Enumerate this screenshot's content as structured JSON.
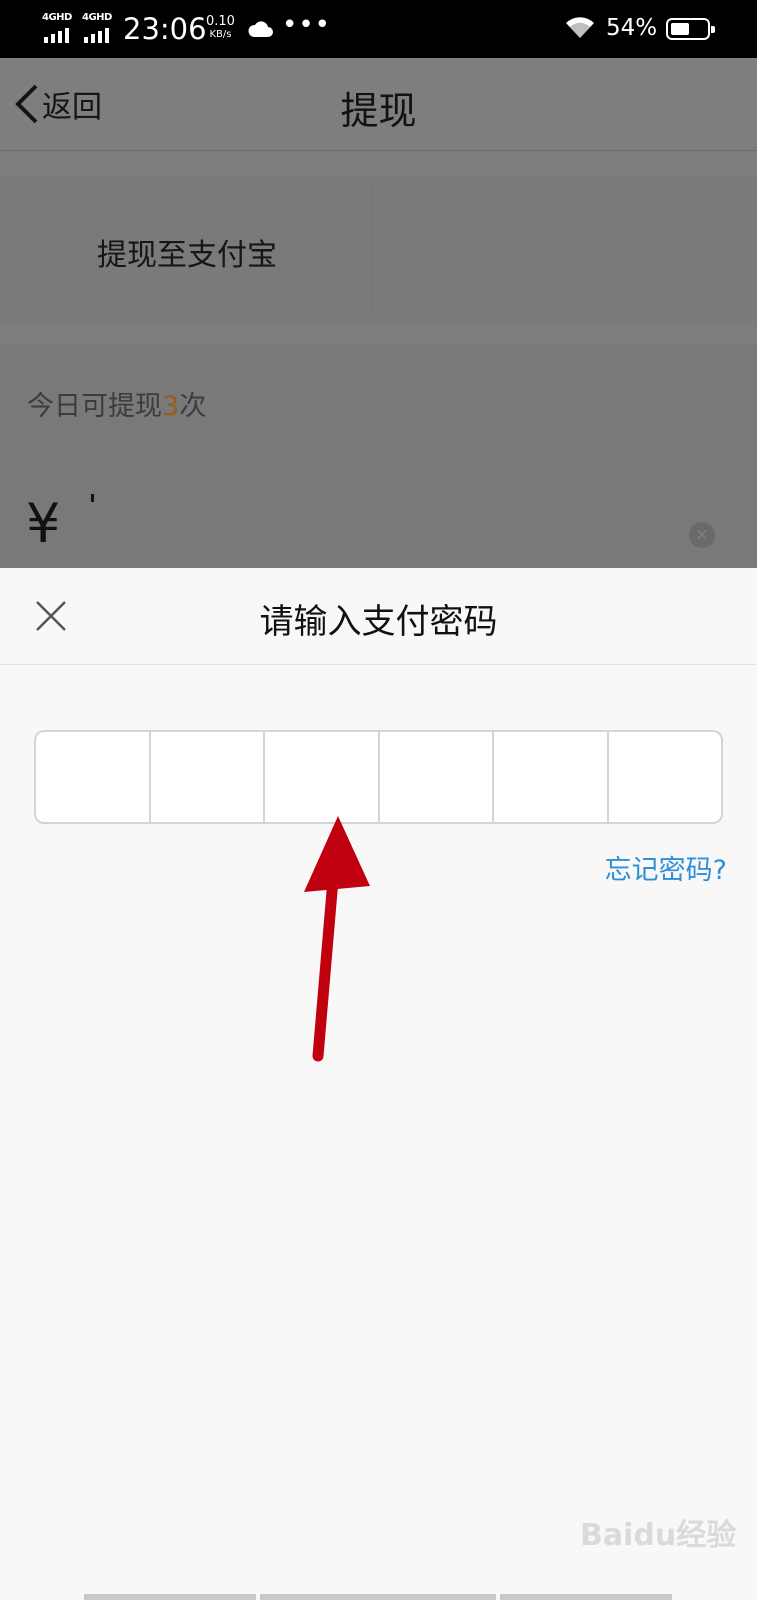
{
  "status_bar": {
    "signal1_label": "4GHD",
    "signal2_label": "4GHD",
    "time": "23:06",
    "net_speed_value": "0.10",
    "net_speed_unit": "KB/s",
    "dots": "•••",
    "battery_pct": "54%",
    "battery_level": 0.54,
    "icons": [
      "signal-icon",
      "signal-icon",
      "cloud-icon",
      "wifi-icon",
      "battery-icon"
    ]
  },
  "nav": {
    "back_label": "返回",
    "title": "提现"
  },
  "withdraw_target": {
    "label": "提现至支付宝"
  },
  "withdraw_info": {
    "times_prefix": "今日可提现",
    "times_count": "3",
    "times_suffix": "次",
    "currency_symbol": "¥",
    "clear_symbol": "×"
  },
  "password_sheet": {
    "title": "请输入支付密码",
    "forgot_label": "忘记密码?",
    "digit_cells": 6,
    "accent_color": "#2f8fd6"
  },
  "annotation": {
    "arrow_color": "#c0000f"
  },
  "watermark": {
    "text": "Baidu经验"
  }
}
